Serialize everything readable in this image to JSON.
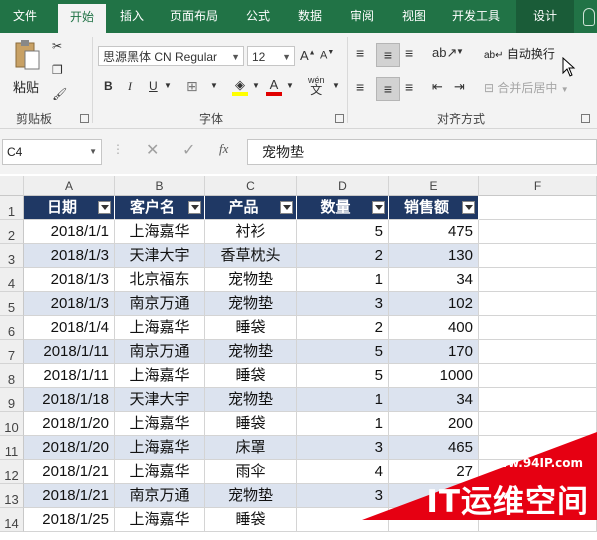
{
  "ribbon_tabs": [
    {
      "label": "文件"
    },
    {
      "label": "开始"
    },
    {
      "label": "插入"
    },
    {
      "label": "页面布局"
    },
    {
      "label": "公式"
    },
    {
      "label": "数据"
    },
    {
      "label": "审阅"
    },
    {
      "label": "视图"
    },
    {
      "label": "开发工具"
    },
    {
      "label": "设计"
    }
  ],
  "clipboard": {
    "paste_label": "粘贴",
    "group_label": "剪贴板"
  },
  "font_group": {
    "font_name": "思源黑体 CN Regular",
    "font_size": "12",
    "bold": "B",
    "italic": "I",
    "underline": "U",
    "grow": "A",
    "shrink": "A",
    "wen": "wén",
    "group_label": "字体"
  },
  "alignment_group": {
    "wrap_text": "自动换行",
    "merge_center": "合并后居中",
    "group_label": "对齐方式"
  },
  "formula_bar": {
    "name_box": "C4",
    "fx": "fx",
    "content": "宠物垫"
  },
  "columns": [
    "A",
    "B",
    "C",
    "D",
    "E",
    "F"
  ],
  "rows": [
    "1",
    "2",
    "3",
    "4",
    "5",
    "6",
    "7",
    "8",
    "9",
    "10",
    "11",
    "12",
    "13",
    "14"
  ],
  "table": {
    "headers": [
      "日期",
      "客户名",
      "产品",
      "数量",
      "销售额"
    ],
    "rows": [
      [
        "2018/1/1",
        "上海嘉华",
        "衬衫",
        "5",
        "475"
      ],
      [
        "2018/1/3",
        "天津大宇",
        "香草枕头",
        "2",
        "130"
      ],
      [
        "2018/1/3",
        "北京福东",
        "宠物垫",
        "1",
        "34"
      ],
      [
        "2018/1/3",
        "南京万通",
        "宠物垫",
        "3",
        "102"
      ],
      [
        "2018/1/4",
        "上海嘉华",
        "睡袋",
        "2",
        "400"
      ],
      [
        "2018/1/11",
        "南京万通",
        "宠物垫",
        "5",
        "170"
      ],
      [
        "2018/1/11",
        "上海嘉华",
        "睡袋",
        "5",
        "1000"
      ],
      [
        "2018/1/18",
        "天津大宇",
        "宠物垫",
        "1",
        "34"
      ],
      [
        "2018/1/20",
        "上海嘉华",
        "睡袋",
        "1",
        "200"
      ],
      [
        "2018/1/20",
        "上海嘉华",
        "床罩",
        "3",
        "465"
      ],
      [
        "2018/1/21",
        "上海嘉华",
        "雨伞",
        "4",
        "27"
      ],
      [
        "2018/1/21",
        "南京万通",
        "宠物垫",
        "3",
        ""
      ],
      [
        "2018/1/25",
        "上海嘉华",
        "睡袋",
        "",
        ""
      ]
    ]
  },
  "watermark": {
    "url": "www.94IP.com",
    "text": "IT运维空间"
  },
  "colors": {
    "excel_green": "#217346",
    "table_header": "#1f3864",
    "band": "#dce3ef",
    "watermark_red": "#e60012"
  }
}
